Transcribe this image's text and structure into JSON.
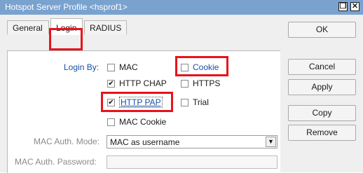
{
  "window": {
    "title": "Hotspot Server Profile <hsprof1>",
    "restore_glyph": "❐",
    "close_glyph": "✕"
  },
  "tabs": [
    {
      "label": "General",
      "active": false
    },
    {
      "label": "Login",
      "active": true
    },
    {
      "label": "RADIUS",
      "active": false
    }
  ],
  "login_by": {
    "label": "Login By:",
    "options": {
      "mac": {
        "label": "MAC",
        "checked": false
      },
      "cookie": {
        "label": "Cookie",
        "checked": false
      },
      "http_chap": {
        "label": "HTTP CHAP",
        "checked": true
      },
      "https": {
        "label": "HTTPS",
        "checked": false
      },
      "http_pap": {
        "label": "HTTP PAP",
        "checked": true
      },
      "trial": {
        "label": "Trial",
        "checked": false
      },
      "mac_cookie": {
        "label": "MAC Cookie",
        "checked": false
      }
    }
  },
  "mac_auth_mode": {
    "label": "MAC Auth. Mode:",
    "value": "MAC as username"
  },
  "mac_auth_password": {
    "label": "MAC Auth. Password:",
    "value": ""
  },
  "buttons": {
    "ok": "OK",
    "cancel": "Cancel",
    "apply": "Apply",
    "copy": "Copy",
    "remove": "Remove"
  },
  "colors": {
    "titlebar": "#7aa2cf",
    "highlight": "#e8131b",
    "link_blue": "#1a4fa0"
  }
}
